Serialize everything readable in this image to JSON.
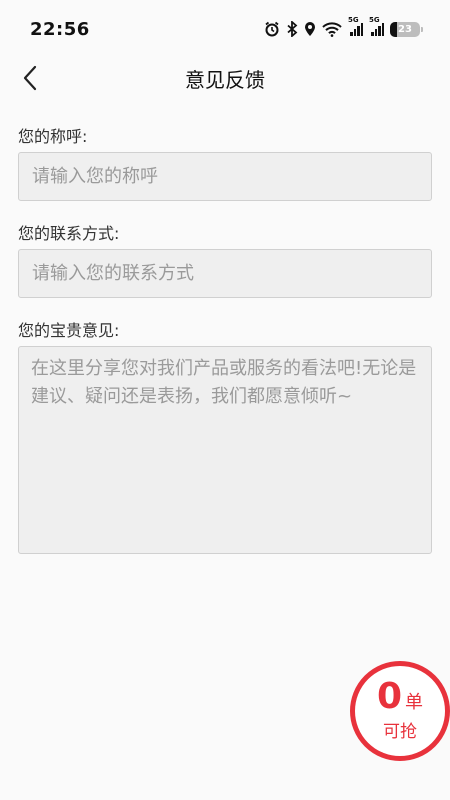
{
  "status_bar": {
    "time": "22:56",
    "network_label_1": "5G",
    "network_label_2": "5G",
    "battery": "23"
  },
  "nav": {
    "title": "意见反馈"
  },
  "form": {
    "name_label": "您的称呼:",
    "name_placeholder": "请输入您的称呼",
    "contact_label": "您的联系方式:",
    "contact_placeholder": "请输入您的联系方式",
    "feedback_label": "您的宝贵意见:",
    "feedback_placeholder": "在这里分享您对我们产品或服务的看法吧!无论是建议、疑问还是表扬，我们都愿意倾听~"
  },
  "orders_badge": {
    "count": "0",
    "unit": "单",
    "caption": "可抢"
  },
  "colors": {
    "accent": "#e8323c",
    "input_bg": "#efefef"
  }
}
